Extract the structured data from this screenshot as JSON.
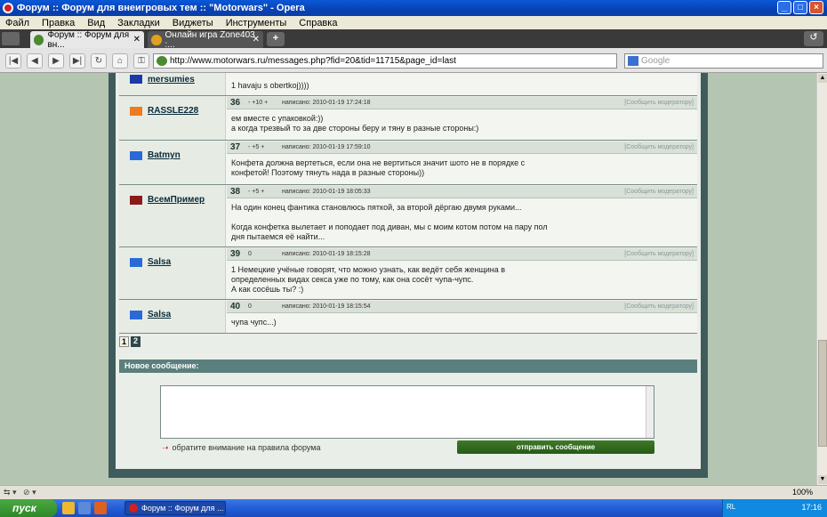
{
  "window": {
    "title": "Форум :: Форум для внеигровых тем :: \"Motorwars\" - Opera"
  },
  "menu": [
    "Файл",
    "Правка",
    "Вид",
    "Закладки",
    "Виджеты",
    "Инструменты",
    "Справка"
  ],
  "tabs": [
    {
      "label": "Форум :: Форум для вн...",
      "active": true
    },
    {
      "label": "Онлайн игра Zone403 :...",
      "active": false
    }
  ],
  "address": {
    "url": "http://www.motorwars.ru/messages.php?fid=20&tid=11715&page_id=last",
    "search_placeholder": "Google"
  },
  "forum": {
    "report_label": "[Сообщить модератору]",
    "posts": [
      {
        "num": "",
        "user": "mersumies",
        "votes": "",
        "date": "",
        "body": "1 havaju s obertkoj))))",
        "flag": "#1a3aa8"
      },
      {
        "num": "36",
        "user": "RASSLE228",
        "votes": "- +10 +",
        "date": "написано: 2010-01-19 17:24:18",
        "body": "ем вместе с упаковкой:))\nа когда трезвый то за две стороны беру и тяну в разные стороны:)",
        "flag": "#f07a20"
      },
      {
        "num": "37",
        "user": "Batmyn",
        "votes": "- +5 +",
        "date": "написано: 2010-01-19 17:59:10",
        "body": "Конфета должна вертеться, если она не вертиться значит шото не в порядке с\nконфетой! Поэтому тянуть нада в разные стороны))",
        "flag": "#2a6ad8"
      },
      {
        "num": "38",
        "user": "ВсемПример",
        "votes": "- +5 +",
        "date": "написано: 2010-01-19 18:05:33",
        "body": "На один конец фантика становлюсь пяткой, за второй дёргаю двумя руками...\n\nКогда конфетка вылетает и поподает под диван, мы с моим котом потом на пару пол\nдня пытаемся её найти...",
        "flag": "#8a1a1a"
      },
      {
        "num": "39",
        "user": "Salsa",
        "votes": "0",
        "date": "написано: 2010-01-19 18:15:28",
        "body": "1 Немецкие учёные говорят, что можно узнать, как ведёт себя женщина в\nопределенных видах секса уже по тому, как она сосёт чупа-чупс.\nА как сосёшь ты? :)",
        "flag": "#2a6ad8"
      },
      {
        "num": "40",
        "user": "Salsa",
        "votes": "0",
        "date": "написано: 2010-01-19 18:15:54",
        "body": "чупа чупс...)",
        "flag": "#2a6ad8"
      }
    ],
    "pages": [
      "1",
      "2"
    ],
    "new_message": {
      "heading": "Новое сообщение:",
      "rules_link": "обратите внимание на правила форума",
      "send_label": "отправить сообщение"
    }
  },
  "statusbar": {
    "zoom": "100%"
  },
  "taskbar": {
    "start": "пуск",
    "window_item": "Форум :: Форум для ...",
    "lang": "RL",
    "clock": "17:16"
  }
}
